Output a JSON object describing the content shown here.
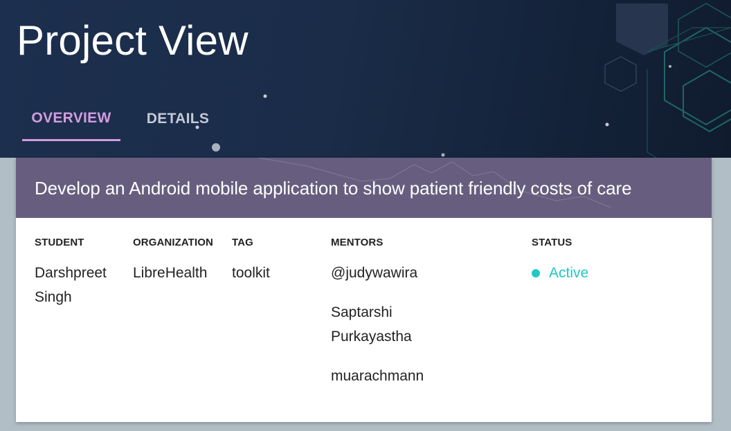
{
  "header": {
    "title": "Project View",
    "tabs": [
      {
        "label": "OVERVIEW",
        "active": true
      },
      {
        "label": "DETAILS",
        "active": false
      }
    ]
  },
  "project": {
    "title": "Develop an Android mobile application to show patient friendly costs of care",
    "columns": {
      "student_label": "STUDENT",
      "organization_label": "ORGANIZATION",
      "tag_label": "TAG",
      "mentors_label": "MENTORS",
      "status_label": "STATUS"
    },
    "student": "Darshpreet Singh",
    "organization": "LibreHealth",
    "tag": "toolkit",
    "mentors": [
      "@judywawira",
      "Saptarshi Purkayastha",
      "muarachmann"
    ],
    "status": "Active"
  },
  "colors": {
    "header_bg": "#1c2f4e",
    "tab_active": "#d39ce0",
    "card_header_bg": "#675e7f",
    "status_active": "#1fc9c4"
  }
}
